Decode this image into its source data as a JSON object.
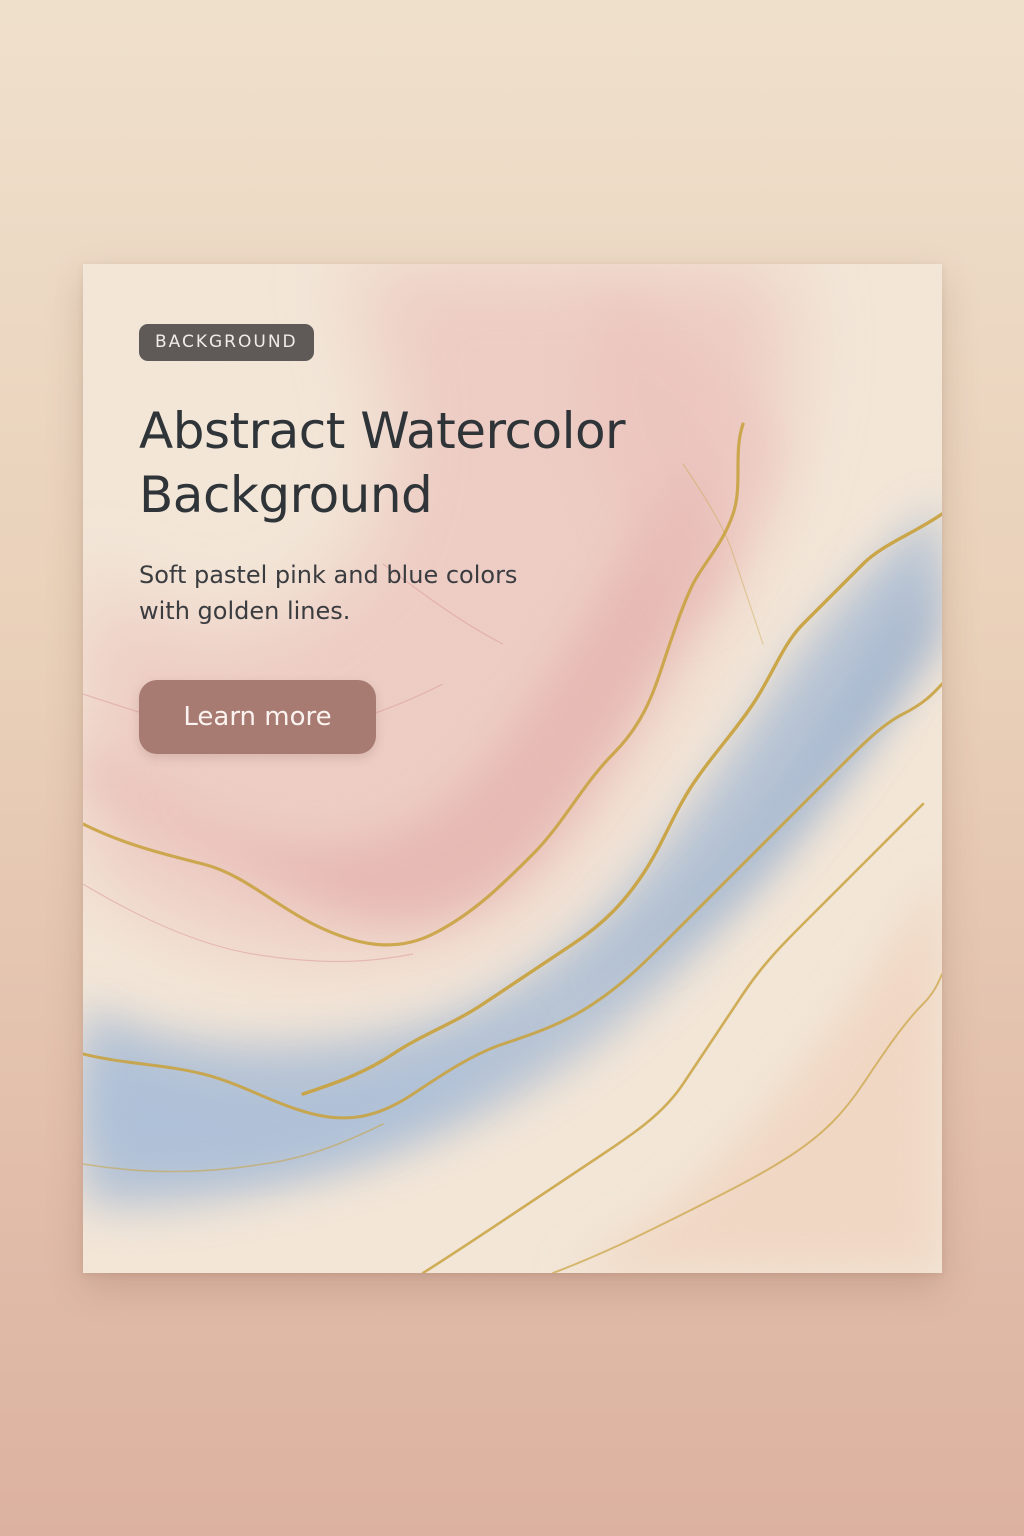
{
  "card": {
    "badge": "BACKGROUND",
    "title_line1": "Abstract Watercolor",
    "title_line2": "Background",
    "subtitle_line1": "Soft pastel pink and blue colors",
    "subtitle_line2": "with golden lines.",
    "cta_label": "Learn more"
  },
  "colors": {
    "page_top": "#efe0cc",
    "page_bottom": "#dcb1a0",
    "card_base": "#f4e7d8",
    "pink": "#e8b6b2",
    "blue": "#9fb6d3",
    "gold": "#c9a23e",
    "badge_bg": "#5f5a58",
    "button_bg": "#a77a72",
    "title_text": "#2f3438"
  }
}
